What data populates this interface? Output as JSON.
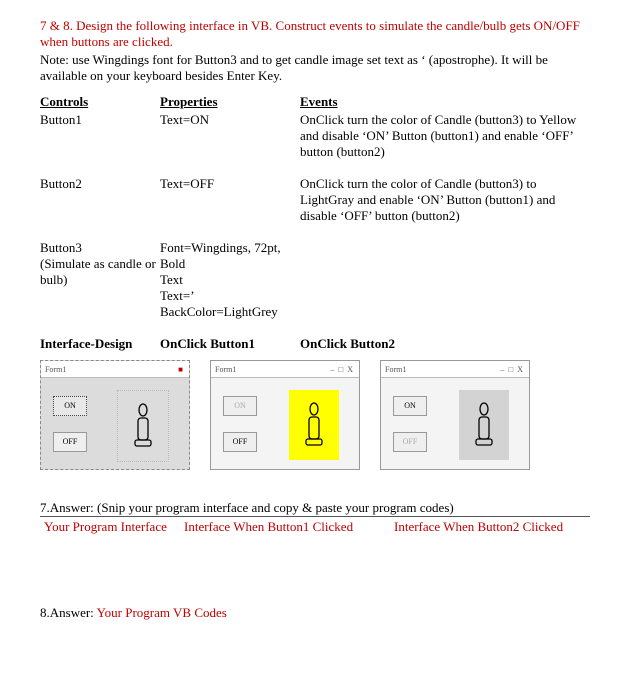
{
  "question78": "7 & 8. Design the following interface in VB.  Construct events to simulate the candle/bulb gets ON/OFF when buttons are clicked.",
  "note": "Note: use Wingdings font for Button3 and to get candle image set text as ‘ (apostrophe). It will be available on your keyboard besides Enter Key.",
  "cols": {
    "controls": "Controls",
    "properties": "Properties",
    "events": "Events"
  },
  "rows": {
    "r1": {
      "control": "Button1",
      "prop": "Text=ON",
      "event": "OnClick turn the color of Candle (button3) to Yellow and disable ‘ON’ Button (button1) and enable ‘OFF’ button (button2)"
    },
    "r2": {
      "control": "Button2",
      "prop": "Text=OFF",
      "event": "OnClick turn the color of Candle (button3) to LightGray and enable ‘ON’ Button (button1) and  disable ‘OFF’ button (button2)"
    },
    "r3": {
      "control": "Button3",
      "control2": "(Simulate as candle or bulb)",
      "prop1": "Font=Wingdings, 72pt, Bold",
      "prop2": "Text",
      "prop3": "Text=’",
      "prop4": "BackColor=LightGrey"
    }
  },
  "iface": {
    "design": "Interface-Design",
    "click1": "OnClick Button1",
    "click2": "OnClick Button2"
  },
  "form": {
    "title": "Form1",
    "min": "–",
    "max": "□",
    "close": "X",
    "on": "ON",
    "off": "OFF"
  },
  "ans7": {
    "head": "7.Answer: (Snip your program interface and copy & paste your program codes)",
    "c1": "Your Program Interface",
    "c2": "Interface When Button1 Clicked",
    "c3": "Interface When Button2 Clicked"
  },
  "ans8": {
    "pre": "8.Answer: ",
    "red": "Your Program VB Codes"
  }
}
